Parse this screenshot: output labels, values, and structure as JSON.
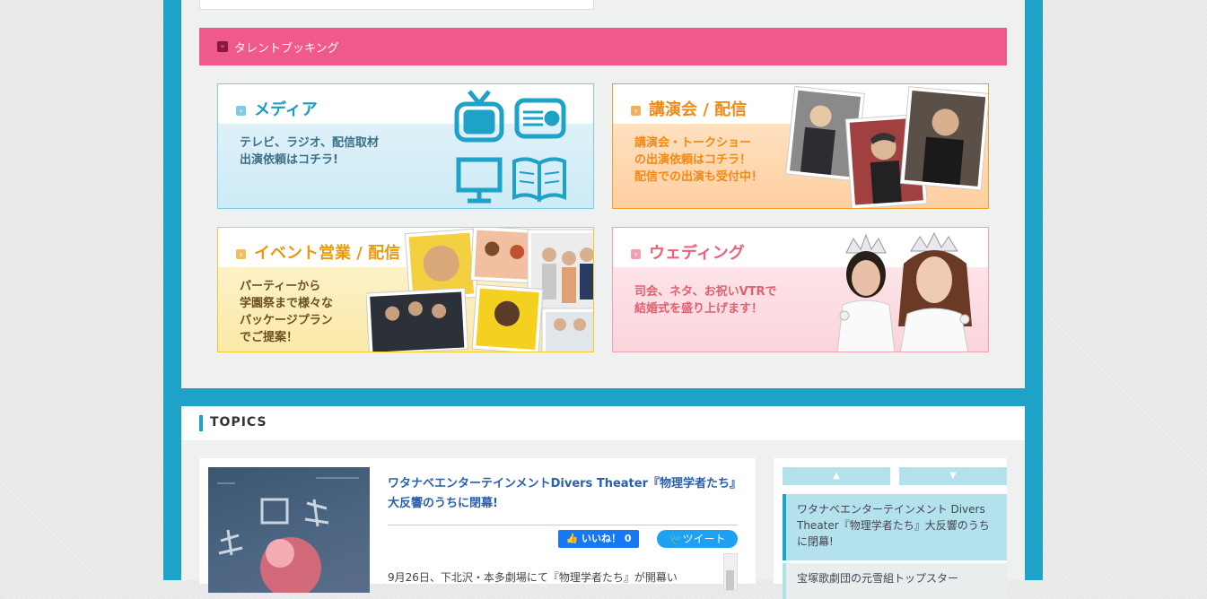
{
  "talent_booking": {
    "header": "タレントブッキング",
    "cards": [
      {
        "title": "メディア",
        "body": "テレビ、ラジオ、配信取材\n出演依頼はコチラ!"
      },
      {
        "title": "講演会 / 配信",
        "body": "講演会・トークショー\nの出演依頼はコチラ！\n配信での出演も受付中！"
      },
      {
        "title": "イベント営業 / 配信",
        "body": "パーティーから\n学園祭まで様々な\nパッケージプラン\nでご提案！"
      },
      {
        "title": "ウェディング",
        "body": "司会、ネタ、お祝いVTRで\n結婚式を盛り上げます！"
      }
    ]
  },
  "topics": {
    "heading": "TOPICS",
    "article": {
      "title": "ワタナベエンターテインメントDivers Theater『物理学者たち』大反響のうちに閉幕!",
      "like_label": "いいね！ 0",
      "tweet_label": "ツイート",
      "body_preview": "9月26日、下北沢・本多劇場にて『物理学者たち』が開幕い"
    },
    "sidebar": {
      "up_label": "▲",
      "down_label": "▼",
      "items": [
        "ワタナベエンターテインメント Divers Theater『物理学者たち』大反響のうちに閉幕!",
        "宝塚歌劇団の元雪組トップスター"
      ]
    }
  },
  "colors": {
    "frame": "#1ea2c8",
    "booking_header": "#f05a8a",
    "panel": "#eff0f0",
    "link": "#2a5fa8"
  }
}
